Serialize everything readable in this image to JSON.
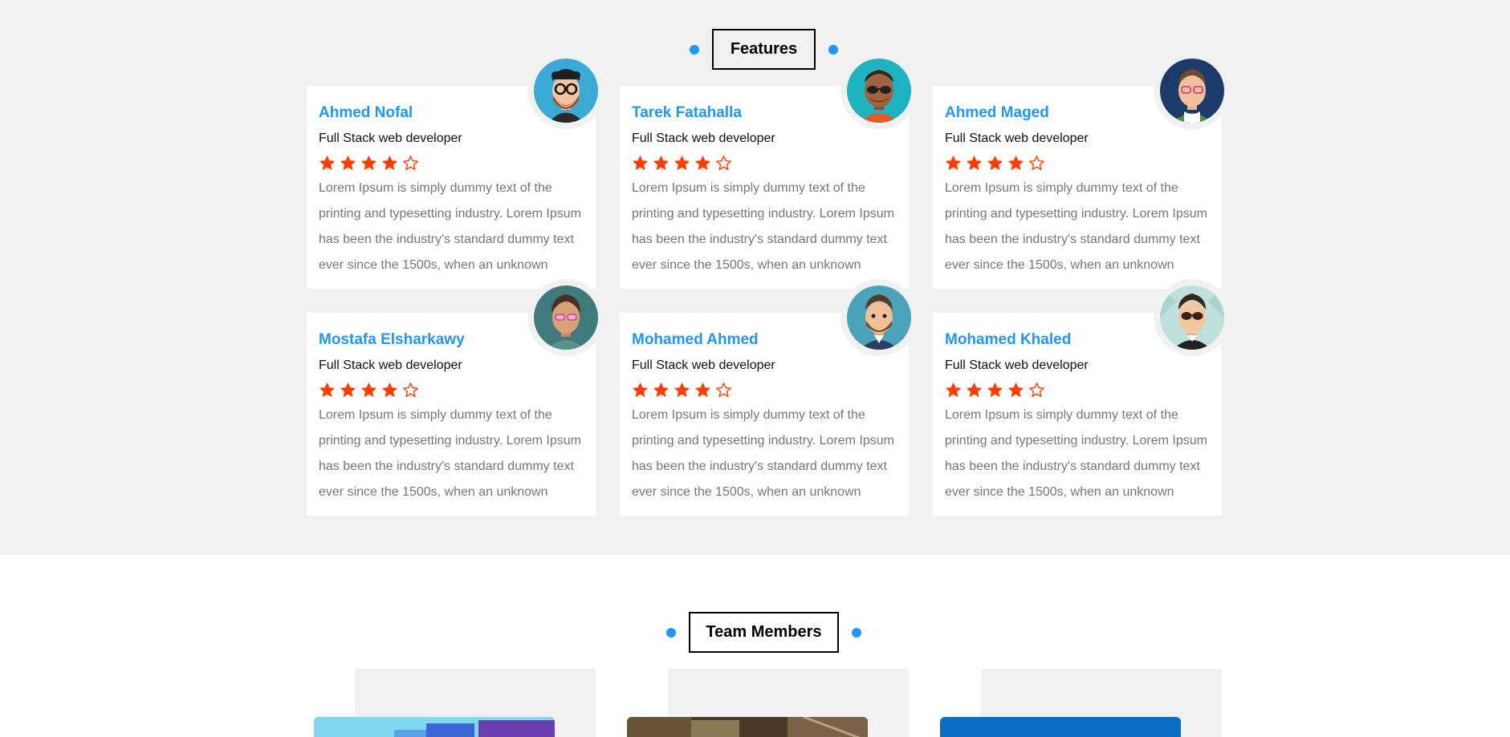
{
  "features": {
    "heading": "Features"
  },
  "testimonials": [
    {
      "name": "Ahmed Nofal",
      "title": "Full Stack web developer",
      "rating": 4,
      "max_rating": 5,
      "text": "Lorem Ipsum is simply dummy text of the printing and typesetting industry. Lorem Ipsum has been the industry's standard dummy text ever since the 1500s, when an unknown"
    },
    {
      "name": "Tarek Fatahalla",
      "title": "Full Stack web developer",
      "rating": 4,
      "max_rating": 5,
      "text": "Lorem Ipsum is simply dummy text of the printing and typesetting industry. Lorem Ipsum has been the industry's standard dummy text ever since the 1500s, when an unknown"
    },
    {
      "name": "Ahmed Maged",
      "title": "Full Stack web developer",
      "rating": 4,
      "max_rating": 5,
      "text": "Lorem Ipsum is simply dummy text of the printing and typesetting industry. Lorem Ipsum has been the industry's standard dummy text ever since the 1500s, when an unknown"
    },
    {
      "name": "Mostafa Elsharkawy",
      "title": "Full Stack web developer",
      "rating": 4,
      "max_rating": 5,
      "text": "Lorem Ipsum is simply dummy text of the printing and typesetting industry. Lorem Ipsum has been the industry's standard dummy text ever since the 1500s, when an unknown"
    },
    {
      "name": "Mohamed Ahmed",
      "title": "Full Stack web developer",
      "rating": 4,
      "max_rating": 5,
      "text": "Lorem Ipsum is simply dummy text of the printing and typesetting industry. Lorem Ipsum has been the industry's standard dummy text ever since the 1500s, when an unknown"
    },
    {
      "name": "Mohamed Khaled",
      "title": "Full Stack web developer",
      "rating": 4,
      "max_rating": 5,
      "text": "Lorem Ipsum is simply dummy text of the printing and typesetting industry. Lorem Ipsum has been the industry's standard dummy text ever since the 1500s, when an unknown"
    }
  ],
  "team": {
    "heading": "Team Members"
  },
  "colors": {
    "accent": "#2196f3",
    "star": "#ff3d00",
    "section_bg": "#f1f1f1",
    "muted_text": "#777777"
  },
  "icons": {
    "star_filled": "star-filled-icon",
    "star_empty": "star-outline-icon",
    "avatar": "avatar-illustration"
  }
}
